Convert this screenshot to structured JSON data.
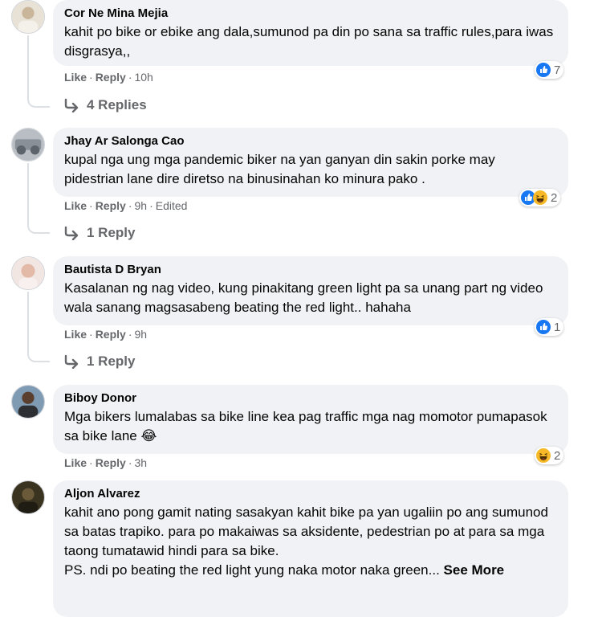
{
  "comments": [
    {
      "author": "Cor Ne Mina Mejia",
      "text": "kahit po bike or ebike ang dala,sumunod pa din po sana sa traffic rules,para iwas disgrasya,,",
      "like": "Like",
      "reply": "Reply",
      "time": "10h",
      "edited": "",
      "reaction_count": "7",
      "reactions": [
        "like-icon"
      ],
      "replies_label": "4 Replies"
    },
    {
      "author": "Jhay Ar Salonga Cao",
      "text": "kupal nga ung mga pandemic biker na yan ganyan din sakin porke may pidestrian lane dire diretso na binusinahan ko minura pako .",
      "like": "Like",
      "reply": "Reply",
      "time": "9h",
      "edited": "Edited",
      "reaction_count": "2",
      "reactions": [
        "like-icon",
        "haha-icon"
      ],
      "replies_label": "1 Reply"
    },
    {
      "author": "Bautista D Bryan",
      "text": "Kasalanan ng nag video, kung pinakitang green light pa sa unang part ng video wala sanang magsasabeng beating the red light.. hahaha",
      "like": "Like",
      "reply": "Reply",
      "time": "9h",
      "edited": "",
      "reaction_count": "1",
      "reactions": [
        "like-icon"
      ],
      "replies_label": "1 Reply"
    },
    {
      "author": "Biboy Donor",
      "text": "Mga bikers lumalabas sa bike line kea pag traffic mga nag momotor pumapasok sa bike lane 😂",
      "like": "Like",
      "reply": "Reply",
      "time": "3h",
      "edited": "",
      "reaction_count": "2",
      "reactions": [
        "haha-icon"
      ],
      "replies_label": ""
    },
    {
      "author": "Aljon Alvarez",
      "text": "kahit ano pong gamit nating sasakyan kahit bike pa yan ugaliin po ang sumunod sa batas trapiko. para po makaiwas sa aksidente, pedestrian po at para sa mga taong tumatawid hindi para sa bike.",
      "text2": "PS. ndi po beating the red light yung naka motor naka green...",
      "see_more": "See More"
    }
  ],
  "colors": {
    "bubble": "#f0f2f5",
    "meta": "#65676b",
    "like_blue": "#1877f2",
    "haha_yellow": "#f7b928"
  }
}
